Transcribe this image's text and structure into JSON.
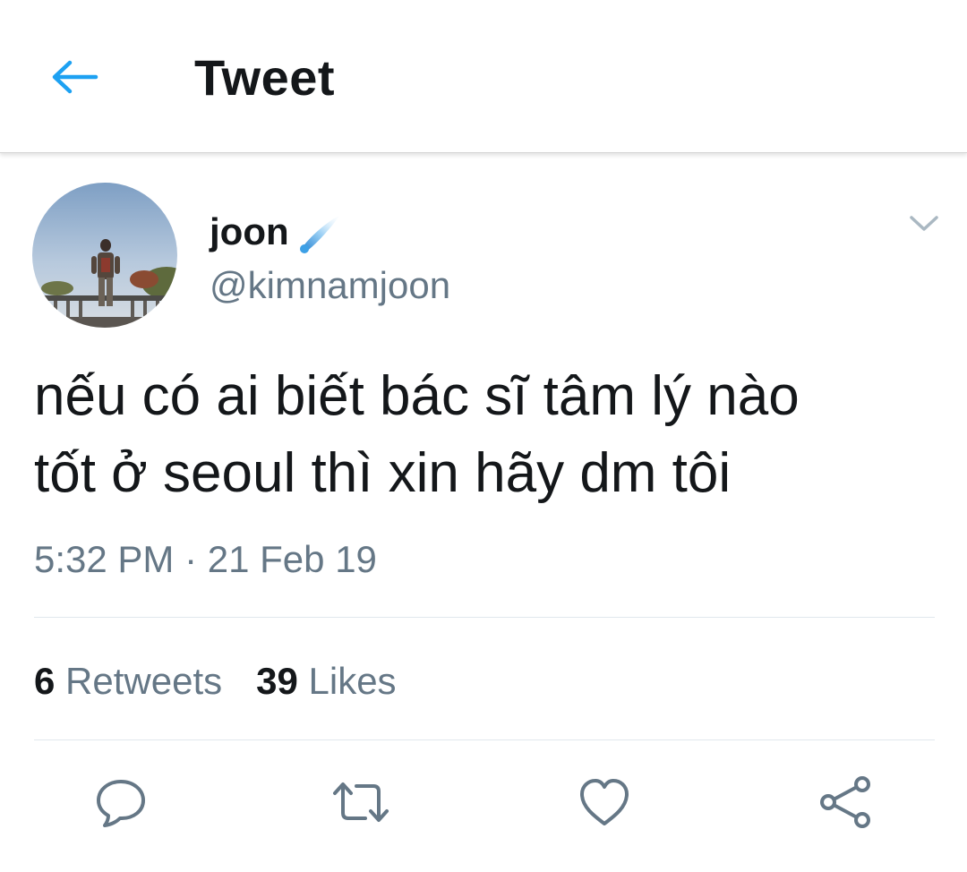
{
  "header": {
    "title": "Tweet",
    "back_icon": "arrow-left-icon",
    "accent": "#1da1f2"
  },
  "tweet": {
    "display_name": "joon",
    "handle": "@kimnamjoon",
    "name_emoji": "comet-emoji",
    "text": "nếu có ai biết bác sĩ tâm lý nào\ntốt ở seoul thì xin hãy dm tôi",
    "time": "5:32 PM",
    "separator": "·",
    "date": "21 Feb 19",
    "caret_icon": "chevron-down-icon"
  },
  "stats": {
    "retweets_count": "6",
    "retweets_label": "Retweets",
    "likes_count": "39",
    "likes_label": "Likes"
  },
  "actions": {
    "reply_icon": "reply-icon",
    "retweet_icon": "retweet-icon",
    "like_icon": "heart-icon",
    "share_icon": "share-icon",
    "icon_color": "#657786"
  },
  "colors": {
    "text_primary": "#14171a",
    "text_secondary": "#657786",
    "divider": "#e1e8ed"
  }
}
